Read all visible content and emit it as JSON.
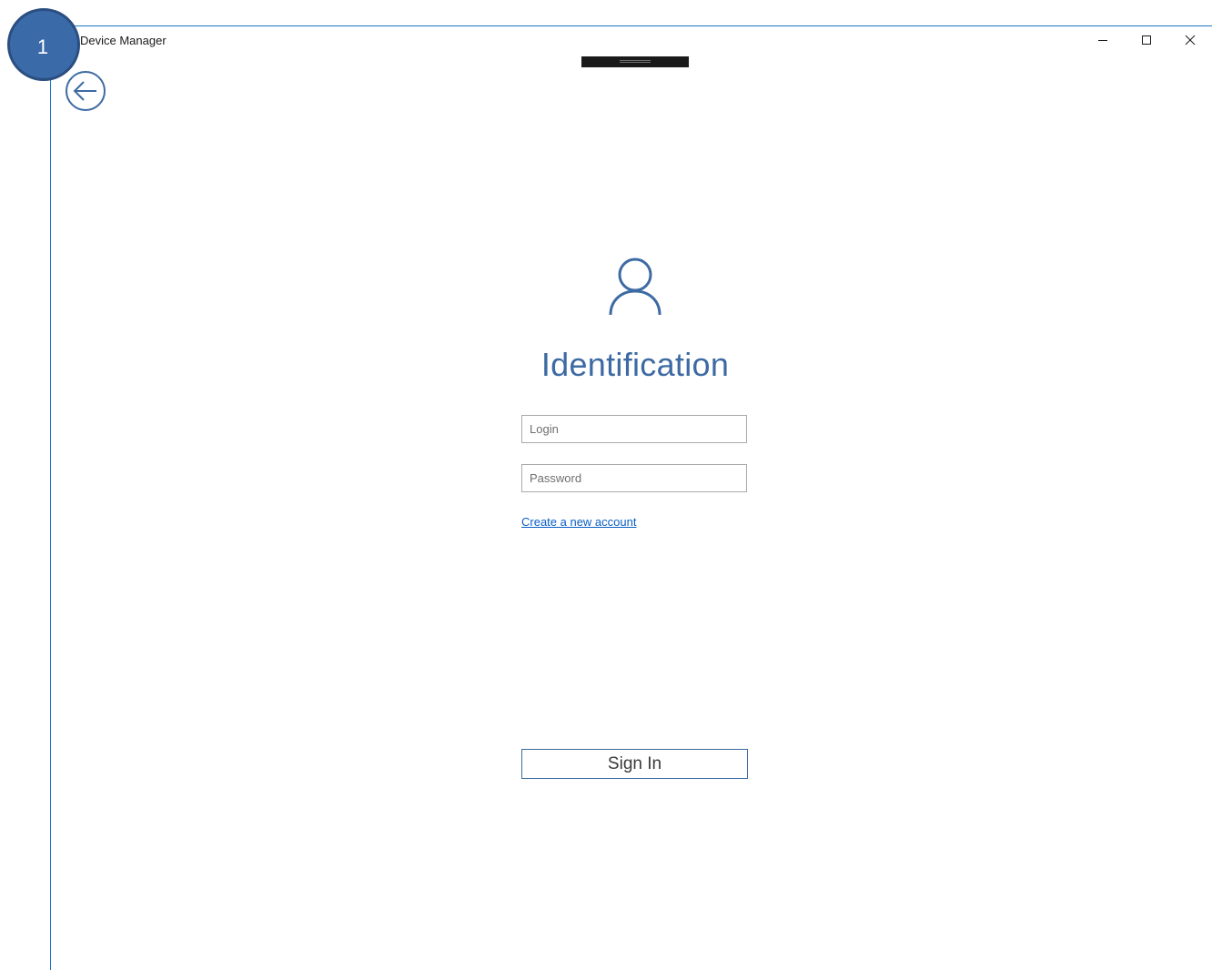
{
  "window": {
    "title": "Device Manager",
    "controls": {
      "minimize": "minimize-icon",
      "maximize": "maximize-icon",
      "close": "close-icon"
    }
  },
  "badge": {
    "number": "1"
  },
  "navigation": {
    "back_icon": "back-arrow-icon"
  },
  "login_form": {
    "user_icon": "user-icon",
    "title": "Identification",
    "login_placeholder": "Login",
    "password_placeholder": "Password",
    "create_account_link": "Create a new account",
    "sign_in_label": "Sign In"
  },
  "colors": {
    "accent": "#3d6aa2",
    "frame": "#1e78c8",
    "link": "#0b5fc4",
    "badge": "#3a6aa8"
  }
}
